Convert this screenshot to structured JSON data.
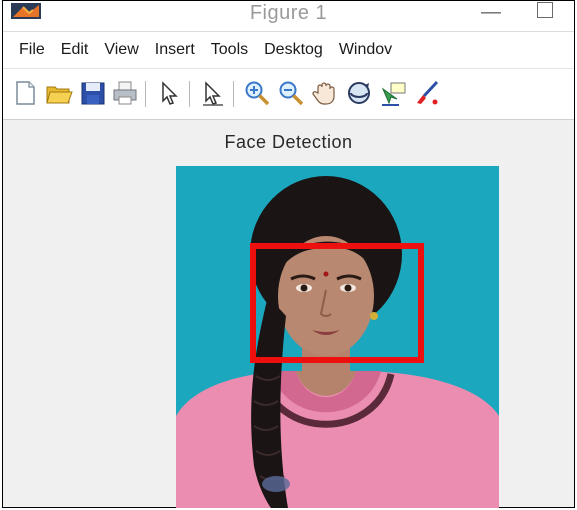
{
  "window": {
    "title": "Figure 1",
    "minimize_glyph": "—"
  },
  "menubar": {
    "items": [
      "File",
      "Edit",
      "View",
      "Insert",
      "Tools",
      "Desktog",
      "Windov"
    ]
  },
  "toolbar": {
    "icons": [
      "new-figure-icon",
      "open-file-icon",
      "save-icon",
      "print-icon",
      "pointer-icon",
      "edit-plot-icon",
      "zoom-in-icon",
      "zoom-out-icon",
      "pan-icon",
      "rotate-3d-icon",
      "data-cursor-icon",
      "brush-icon"
    ]
  },
  "figure": {
    "axes_title": "Face Detection",
    "photo_subject": "portrait-photo",
    "detection_box_color": "#ee0f0f",
    "background_color": "#1ba7be"
  }
}
